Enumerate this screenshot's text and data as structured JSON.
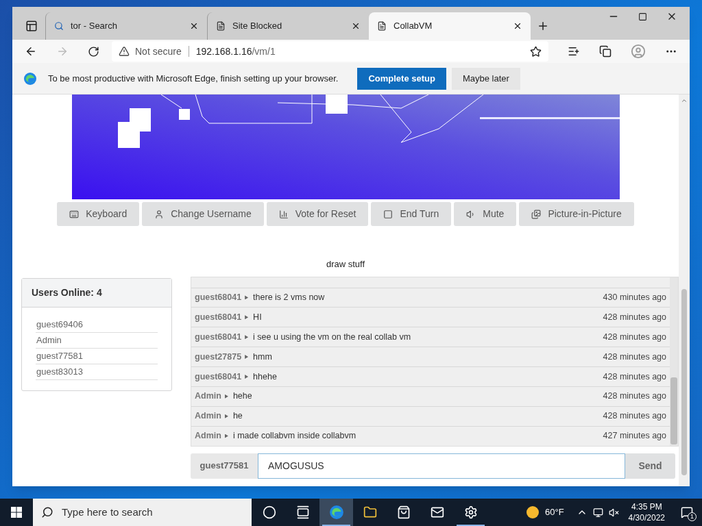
{
  "browser": {
    "tabs": [
      {
        "kind": "search",
        "label": "tor - Search",
        "selected": false
      },
      {
        "kind": "page",
        "label": "Site Blocked",
        "selected": false
      },
      {
        "kind": "page",
        "label": "CollabVM",
        "selected": true
      }
    ],
    "address": {
      "security": "Not secure",
      "host": "192.168.1.16",
      "path": "/vm/1"
    },
    "infobar": {
      "message": "To be most productive with Microsoft Edge, finish setting up your browser.",
      "buttons": [
        {
          "label": "Complete setup",
          "kind": "primary"
        },
        {
          "label": "Maybe later",
          "kind": "secondary"
        }
      ]
    }
  },
  "vm": {
    "buttons": [
      {
        "label": "Keyboard"
      },
      {
        "label": "Change Username"
      },
      {
        "label": "Vote for Reset"
      },
      {
        "label": "End Turn"
      },
      {
        "label": "Mute"
      },
      {
        "label": "Picture-in-Picture"
      }
    ],
    "title": "draw stuff"
  },
  "users": {
    "title": "Users Online: 4",
    "items": [
      "guest69406",
      "Admin",
      "guest77581",
      "guest83013"
    ]
  },
  "chat": {
    "messages": [
      {
        "user": "guest68041",
        "text": "there is 2 vms now",
        "time": "430 minutes ago"
      },
      {
        "user": "guest68041",
        "text": "HI",
        "time": "428 minutes ago"
      },
      {
        "user": "guest68041",
        "text": "i see u using the vm on the real collab vm",
        "time": "428 minutes ago"
      },
      {
        "user": "guest27875",
        "text": "hmm",
        "time": "428 minutes ago"
      },
      {
        "user": "guest68041",
        "text": "hhehe",
        "time": "428 minutes ago"
      },
      {
        "user": "Admin",
        "text": "hehe",
        "time": "428 minutes ago"
      },
      {
        "user": "Admin",
        "text": "he",
        "time": "428 minutes ago"
      },
      {
        "user": "Admin",
        "text": "i made collabvm inside collabvm",
        "time": "427 minutes ago"
      }
    ],
    "username": "guest77581",
    "input": "AMOGUSUS",
    "send": "Send"
  },
  "taskbar": {
    "search_placeholder": "Type here to search",
    "apps": [
      {
        "selected": false,
        "running": false
      },
      {
        "selected": false,
        "running": false
      },
      {
        "selected": true,
        "running": true
      },
      {
        "selected": false,
        "running": false
      },
      {
        "selected": false,
        "running": false
      },
      {
        "selected": false,
        "running": false
      },
      {
        "selected": false,
        "running": true
      }
    ],
    "weather": "60°F",
    "time": "4:35 PM",
    "date": "4/30/2022",
    "notifications": "1"
  }
}
